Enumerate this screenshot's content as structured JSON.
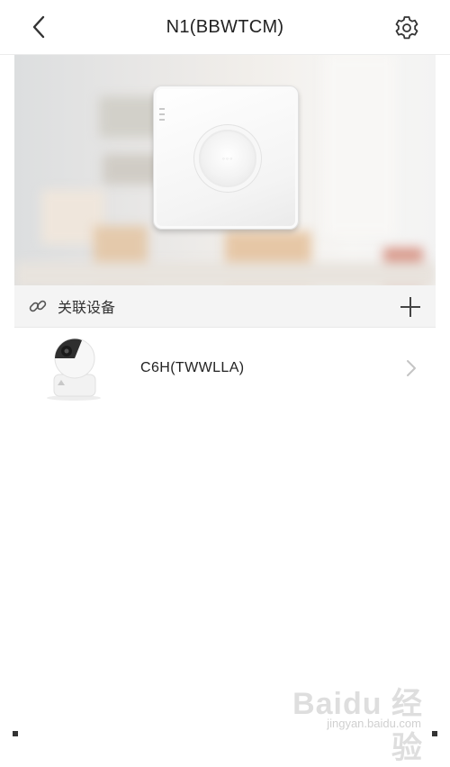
{
  "header": {
    "title": "N1(BBWTCM)",
    "back_icon": "chevron-left-icon",
    "settings_icon": "gear-icon"
  },
  "hero": {
    "device_image": "nvr-box-image"
  },
  "linked_section": {
    "label": "关联设备",
    "link_icon": "link-icon",
    "add_icon": "plus-icon"
  },
  "devices": [
    {
      "name": "C6H(TWWLLA)",
      "thumbnail": "camera-thumbnail",
      "chevron_icon": "chevron-right-icon"
    }
  ],
  "watermark": {
    "brand": "Baidu 经验",
    "url": "jingyan.baidu.com"
  }
}
